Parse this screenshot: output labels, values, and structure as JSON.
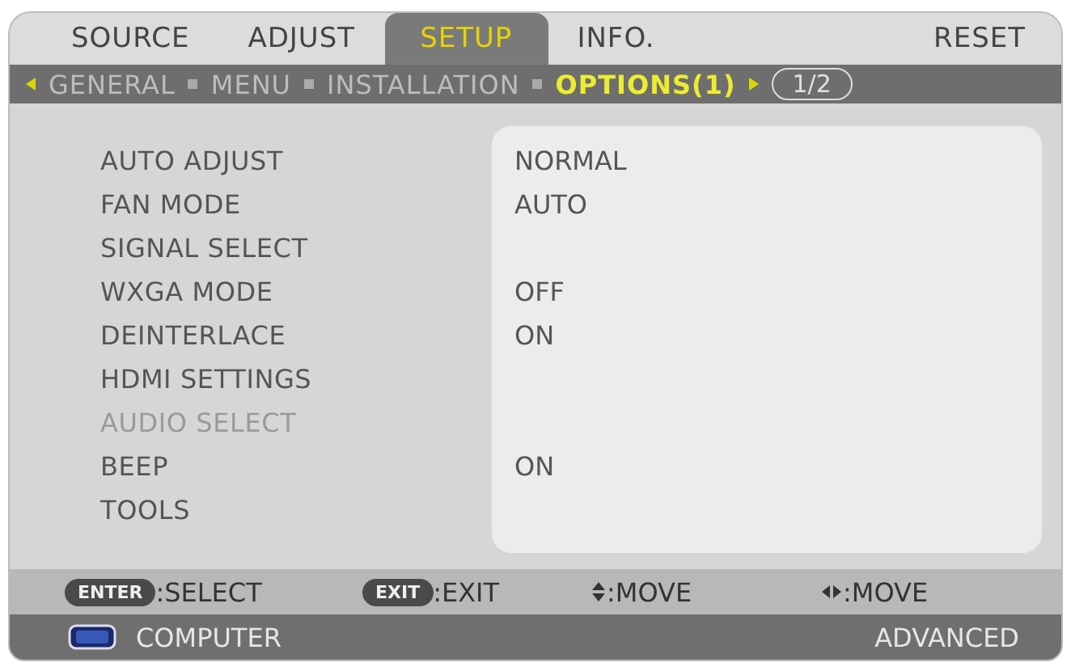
{
  "tabs": [
    {
      "label": "SOURCE",
      "selected": false
    },
    {
      "label": "ADJUST",
      "selected": false
    },
    {
      "label": "SETUP",
      "selected": true
    },
    {
      "label": "INFO.",
      "selected": false
    },
    {
      "label": "RESET",
      "selected": false
    }
  ],
  "subtabs": [
    {
      "label": "GENERAL",
      "selected": false
    },
    {
      "label": "MENU",
      "selected": false
    },
    {
      "label": "INSTALLATION",
      "selected": false
    },
    {
      "label": "OPTIONS(1)",
      "selected": true
    }
  ],
  "page": "1/2",
  "items": [
    {
      "label": "AUTO ADJUST",
      "value": "NORMAL",
      "disabled": false
    },
    {
      "label": "FAN MODE",
      "value": "AUTO",
      "disabled": false
    },
    {
      "label": "SIGNAL SELECT",
      "disabled": false
    },
    {
      "label": "WXGA MODE",
      "value": "OFF",
      "disabled": false
    },
    {
      "label": "DEINTERLACE",
      "value": "ON",
      "disabled": false
    },
    {
      "label": "HDMI SETTINGS",
      "disabled": false
    },
    {
      "label": "AUDIO SELECT",
      "disabled": true
    },
    {
      "label": "BEEP",
      "value": "ON",
      "disabled": false
    },
    {
      "label": "TOOLS",
      "disabled": false
    }
  ],
  "hints": [
    {
      "kind": "key",
      "key": "ENTER",
      "text": ":SELECT"
    },
    {
      "kind": "key",
      "key": "EXIT",
      "text": ":EXIT"
    },
    {
      "kind": "updown",
      "text": ":MOVE"
    },
    {
      "kind": "leftright",
      "text": ":MOVE"
    }
  ],
  "status": {
    "source": "COMPUTER",
    "mode": "ADVANCED"
  }
}
